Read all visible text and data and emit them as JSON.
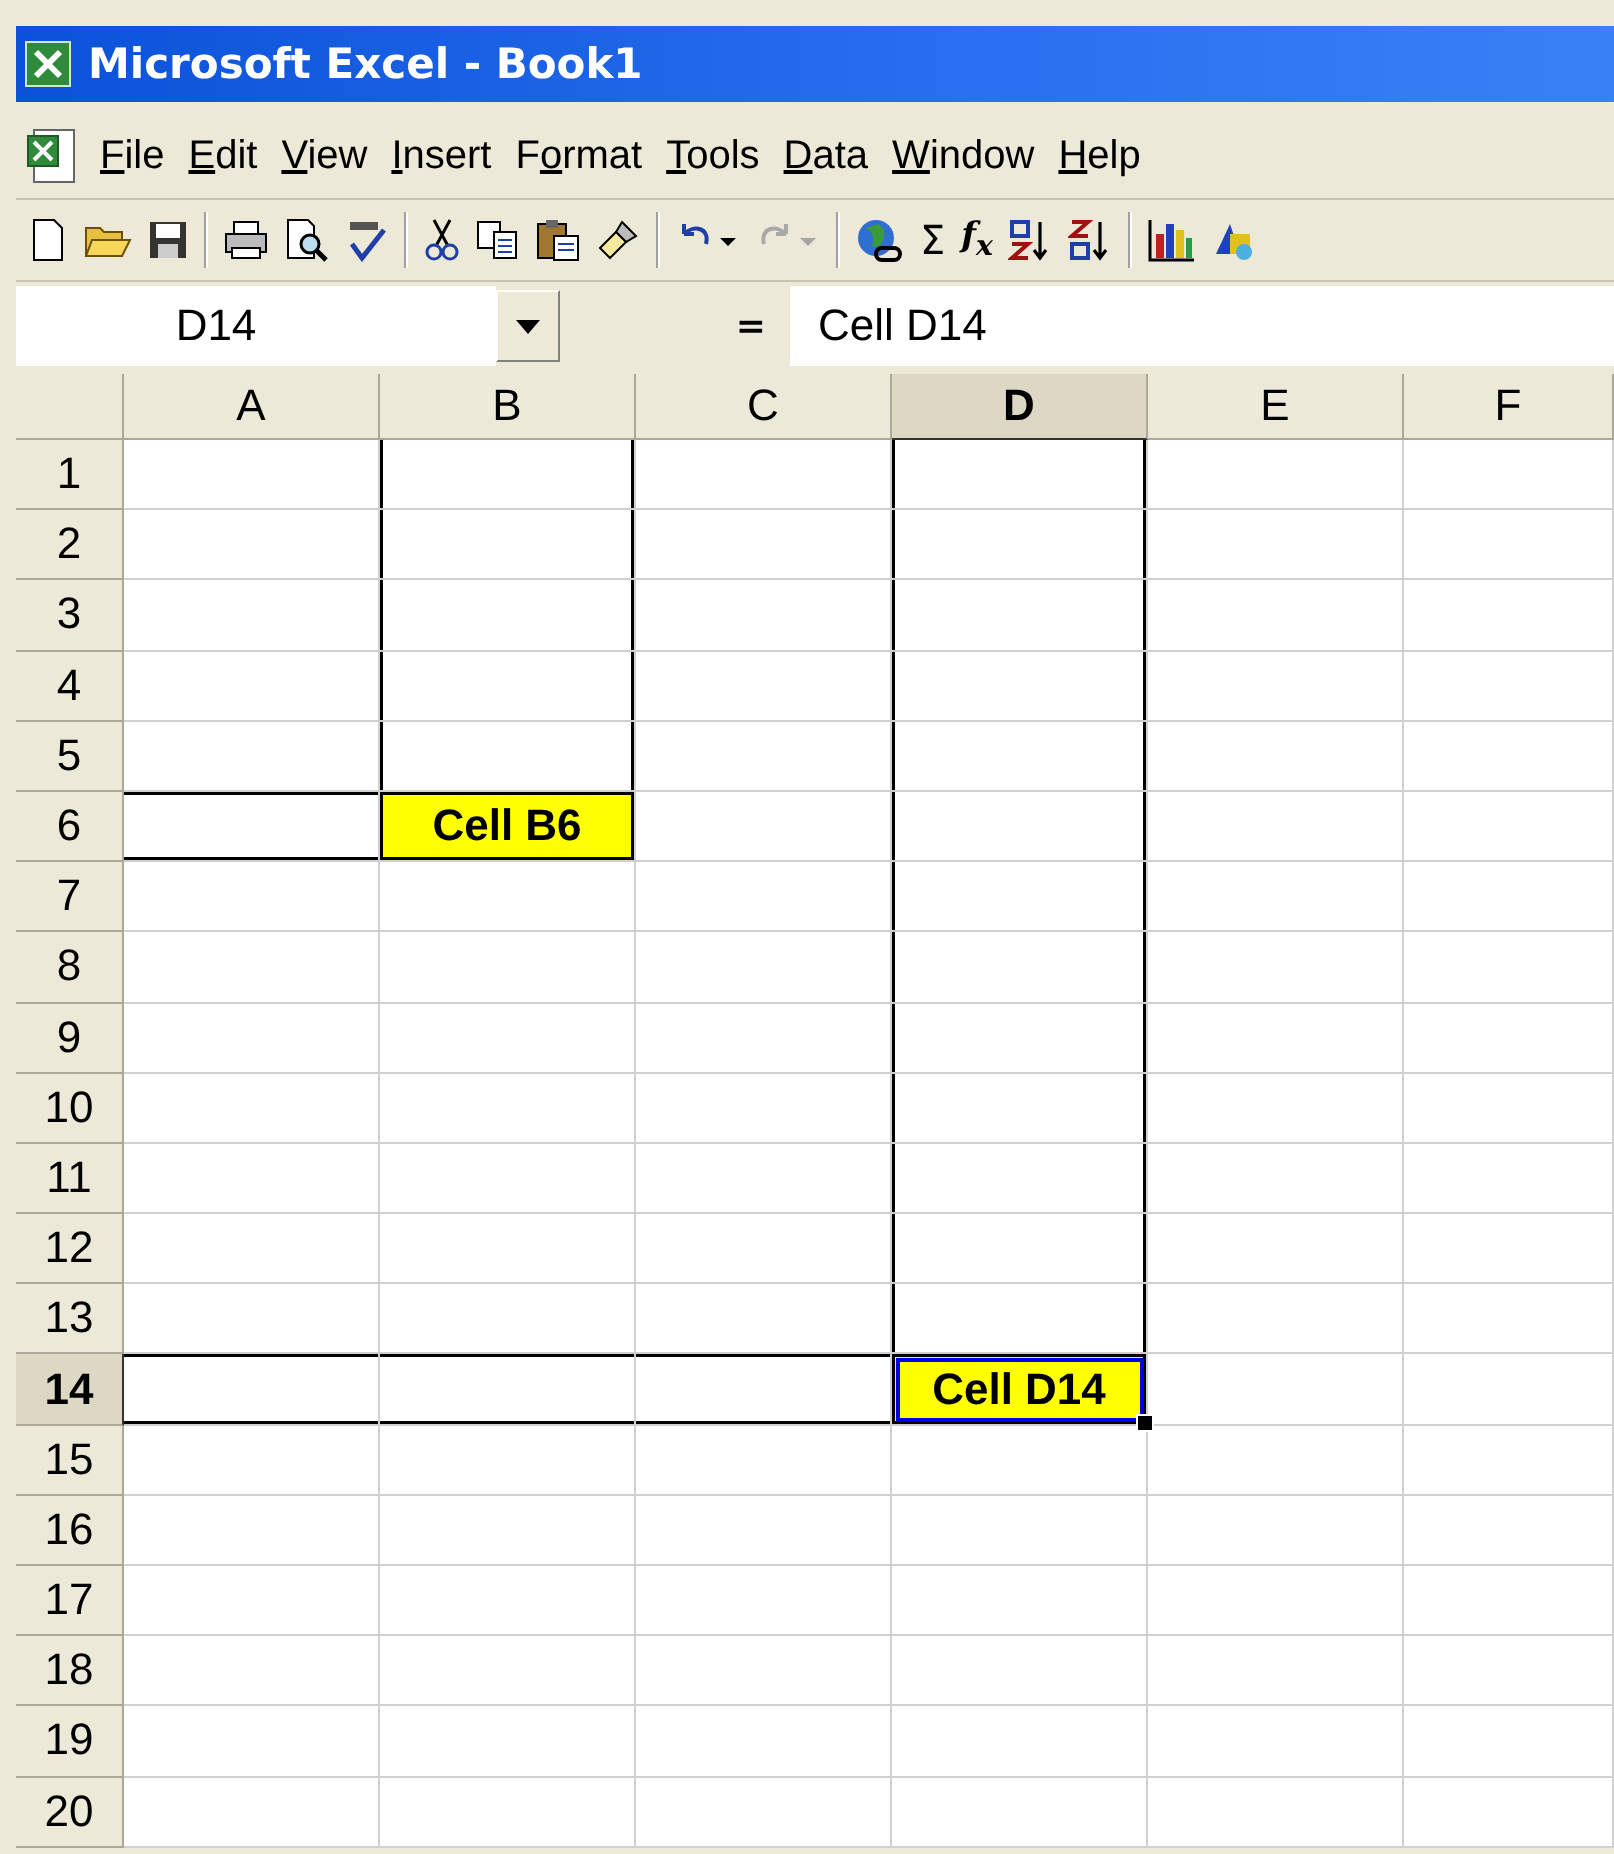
{
  "window": {
    "title": "Microsoft Excel - Book1"
  },
  "menu": [
    {
      "key": "F",
      "after": "ile"
    },
    {
      "key": "E",
      "after": "dit"
    },
    {
      "key": "V",
      "after": "iew"
    },
    {
      "key": "I",
      "after": "nsert"
    },
    {
      "before": "F",
      "key": "o",
      "after": "rmat"
    },
    {
      "key": "T",
      "after": "ools"
    },
    {
      "key": "D",
      "after": "ata"
    },
    {
      "key": "W",
      "after": "indow"
    },
    {
      "key": "H",
      "after": "elp"
    }
  ],
  "toolbar": {
    "undo": {
      "disabled": false
    },
    "redo": {
      "disabled": true
    },
    "sum": "Σ",
    "function": "f$_{x}$"
  },
  "formula_bar": {
    "name_box": "D14",
    "equals": "=",
    "formula": "Cell D14"
  },
  "sheet": {
    "columns": [
      {
        "label": "A",
        "selected": false
      },
      {
        "label": "B",
        "selected": false
      },
      {
        "label": "C",
        "selected": false
      },
      {
        "label": "D",
        "selected": true
      },
      {
        "label": "E",
        "selected": false
      },
      {
        "label": "F",
        "selected": false
      }
    ],
    "rows": [
      {
        "label": "1",
        "selected": false,
        "cells": [
          {
            "selected": false
          },
          {
            "selected": false,
            "kind": "sides"
          },
          {
            "selected": false
          },
          {
            "selected": false,
            "kind": "sides"
          },
          {
            "selected": false
          },
          {
            "selected": false
          }
        ]
      },
      {
        "label": "2",
        "selected": false,
        "cells": [
          {
            "selected": false
          },
          {
            "selected": false,
            "kind": "sides"
          },
          {
            "selected": false
          },
          {
            "selected": false,
            "kind": "sides"
          },
          {
            "selected": false
          },
          {
            "selected": false
          }
        ]
      },
      {
        "label": "3",
        "selected": false,
        "cells": [
          {
            "selected": false
          },
          {
            "selected": false,
            "kind": "sides"
          },
          {
            "selected": false
          },
          {
            "selected": false,
            "kind": "sides"
          },
          {
            "selected": false
          },
          {
            "selected": false
          }
        ]
      },
      {
        "label": "4",
        "selected": false,
        "cells": [
          {
            "selected": false
          },
          {
            "selected": false,
            "kind": "sides"
          },
          {
            "selected": false
          },
          {
            "selected": false,
            "kind": "sides"
          },
          {
            "selected": false
          },
          {
            "selected": false
          }
        ]
      },
      {
        "label": "5",
        "selected": false,
        "cells": [
          {
            "selected": false
          },
          {
            "selected": false,
            "kind": "sides"
          },
          {
            "selected": false
          },
          {
            "selected": false,
            "kind": "sides"
          },
          {
            "selected": false
          },
          {
            "selected": false
          }
        ]
      },
      {
        "label": "6",
        "selected": false,
        "cells": [
          {
            "selected": false,
            "kind": "rule"
          },
          {
            "selected": false,
            "kind": "boxed",
            "text": "Cell B6",
            "color": "#ffff00"
          },
          {
            "selected": false
          },
          {
            "selected": false,
            "kind": "sides"
          },
          {
            "selected": false
          },
          {
            "selected": false
          }
        ]
      },
      {
        "label": "7",
        "selected": false,
        "cells": [
          {
            "selected": false
          },
          {
            "selected": false
          },
          {
            "selected": false
          },
          {
            "selected": false,
            "kind": "sides"
          },
          {
            "selected": false
          },
          {
            "selected": false
          }
        ]
      },
      {
        "label": "8",
        "selected": false,
        "cells": [
          {
            "selected": false
          },
          {
            "selected": false
          },
          {
            "selected": false
          },
          {
            "selected": false,
            "kind": "sides"
          },
          {
            "selected": false
          },
          {
            "selected": false
          }
        ]
      },
      {
        "label": "9",
        "selected": false,
        "cells": [
          {
            "selected": false
          },
          {
            "selected": false
          },
          {
            "selected": false
          },
          {
            "selected": false,
            "kind": "sides"
          },
          {
            "selected": false
          },
          {
            "selected": false
          }
        ]
      },
      {
        "label": "10",
        "selected": false,
        "cells": [
          {
            "selected": false
          },
          {
            "selected": false
          },
          {
            "selected": false
          },
          {
            "selected": false,
            "kind": "sides"
          },
          {
            "selected": false
          },
          {
            "selected": false
          }
        ]
      },
      {
        "label": "11",
        "selected": false,
        "cells": [
          {
            "selected": false
          },
          {
            "selected": false
          },
          {
            "selected": false
          },
          {
            "selected": false,
            "kind": "sides"
          },
          {
            "selected": false
          },
          {
            "selected": false
          }
        ]
      },
      {
        "label": "12",
        "selected": false,
        "cells": [
          {
            "selected": false
          },
          {
            "selected": false
          },
          {
            "selected": false
          },
          {
            "selected": false,
            "kind": "sides"
          },
          {
            "selected": false
          },
          {
            "selected": false
          }
        ]
      },
      {
        "label": "13",
        "selected": false,
        "cells": [
          {
            "selected": false
          },
          {
            "selected": false
          },
          {
            "selected": false
          },
          {
            "selected": false,
            "kind": "sides"
          },
          {
            "selected": false
          },
          {
            "selected": false
          }
        ]
      },
      {
        "label": "14",
        "selected": true,
        "cells": [
          {
            "selected": false,
            "kind": "rule"
          },
          {
            "selected": false,
            "kind": "rule"
          },
          {
            "selected": false,
            "kind": "rule"
          },
          {
            "selected": true,
            "kind": "boxed",
            "text": "Cell D14",
            "color": "#ffff00"
          },
          {
            "selected": false
          },
          {
            "selected": false
          }
        ]
      },
      {
        "label": "15",
        "selected": false,
        "cells": [
          {
            "selected": false
          },
          {
            "selected": false
          },
          {
            "selected": false
          },
          {
            "selected": false
          },
          {
            "selected": false
          },
          {
            "selected": false
          }
        ]
      },
      {
        "label": "16",
        "selected": false,
        "cells": [
          {
            "selected": false
          },
          {
            "selected": false
          },
          {
            "selected": false
          },
          {
            "selected": false
          },
          {
            "selected": false
          },
          {
            "selected": false
          }
        ]
      },
      {
        "label": "17",
        "selected": false,
        "cells": [
          {
            "selected": false
          },
          {
            "selected": false
          },
          {
            "selected": false
          },
          {
            "selected": false
          },
          {
            "selected": false
          },
          {
            "selected": false
          }
        ]
      },
      {
        "label": "18",
        "selected": false,
        "cells": [
          {
            "selected": false
          },
          {
            "selected": false
          },
          {
            "selected": false
          },
          {
            "selected": false
          },
          {
            "selected": false
          },
          {
            "selected": false
          }
        ]
      },
      {
        "label": "19",
        "selected": false,
        "cells": [
          {
            "selected": false
          },
          {
            "selected": false
          },
          {
            "selected": false
          },
          {
            "selected": false
          },
          {
            "selected": false
          },
          {
            "selected": false
          }
        ]
      },
      {
        "label": "20",
        "selected": false,
        "cells": [
          {
            "selected": false
          },
          {
            "selected": false
          },
          {
            "selected": false
          },
          {
            "selected": false
          },
          {
            "selected": false
          },
          {
            "selected": false
          }
        ]
      }
    ]
  }
}
